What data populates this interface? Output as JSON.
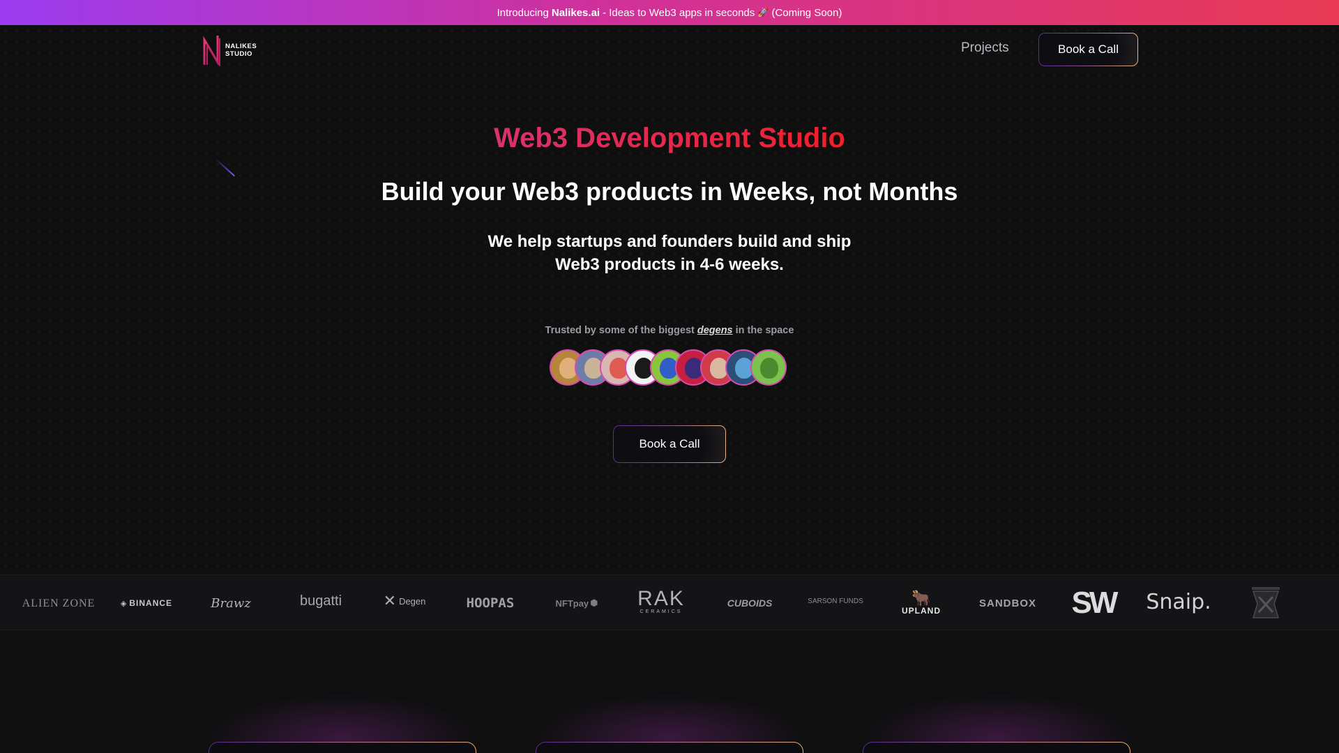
{
  "banner": {
    "prefix": "Introducing",
    "brand": "Nalikes.ai",
    "suffix": "- Ideas to Web3 apps in seconds",
    "icon": "rocket-icon",
    "note": "(Coming Soon)"
  },
  "logo": {
    "line1": "NALIKES",
    "line2": "STUDIO"
  },
  "nav": {
    "projects": "Projects",
    "cta": "Book a Call"
  },
  "hero": {
    "eyebrow": "Web3 Development Studio",
    "headline": "Build your Web3 products in Weeks, not Months",
    "sub_line1": "We help startups and founders build and ship",
    "sub_line2": "Web3 products in 4-6 weeks.",
    "trusted_prefix": "Trusted by some of the biggest",
    "trusted_emph": "degens",
    "trusted_suffix": "in the space",
    "cta": "Book a Call"
  },
  "avatars": [
    {
      "bg": "#b8863a",
      "face": "#e0b07a"
    },
    {
      "bg": "#6f7ca8",
      "face": "#c9b497"
    },
    {
      "bg": "#d8b7b0",
      "face": "#e05b4f"
    },
    {
      "bg": "#f2f2f2",
      "face": "#1a1a1a"
    },
    {
      "bg": "#8ac63b",
      "face": "#2f5ec7"
    },
    {
      "bg": "#c61f3f",
      "face": "#3a2a7a"
    },
    {
      "bg": "#cf3b46",
      "face": "#d8b8a0"
    },
    {
      "bg": "#2e4e7a",
      "face": "#5aa3d6"
    },
    {
      "bg": "#7bc24e",
      "face": "#4b8a2f"
    }
  ],
  "partners": [
    {
      "name": "ALIEN ZONE",
      "icon": ""
    },
    {
      "name": "BINANCE",
      "icon": "binance-icon"
    },
    {
      "name": "Brawz",
      "icon": ""
    },
    {
      "name": "bugatti",
      "icon": ""
    },
    {
      "name": "Degen",
      "icon": "x-icon"
    },
    {
      "name": "HOOPAS",
      "icon": ""
    },
    {
      "name": "NFTpay",
      "icon": "hexagon-icon"
    },
    {
      "name": "RAK",
      "sub": "CERAMICS",
      "icon": ""
    },
    {
      "name": "CUBOIDS",
      "icon": ""
    },
    {
      "name": "SARSON FUNDS",
      "icon": ""
    },
    {
      "name": "UPLAND",
      "icon": "bull-icon"
    },
    {
      "name": "SANDBOX",
      "icon": ""
    },
    {
      "name": "SW",
      "icon": ""
    },
    {
      "name": "Snaip.",
      "icon": ""
    },
    {
      "name": "",
      "icon": "crest-icon"
    }
  ],
  "colors": {
    "banner_start": "#9b3cf0",
    "banner_end": "#e83a55",
    "eyebrow_start": "#d9326f",
    "eyebrow_end": "#ef1f2a",
    "background": "#0f0f10"
  }
}
